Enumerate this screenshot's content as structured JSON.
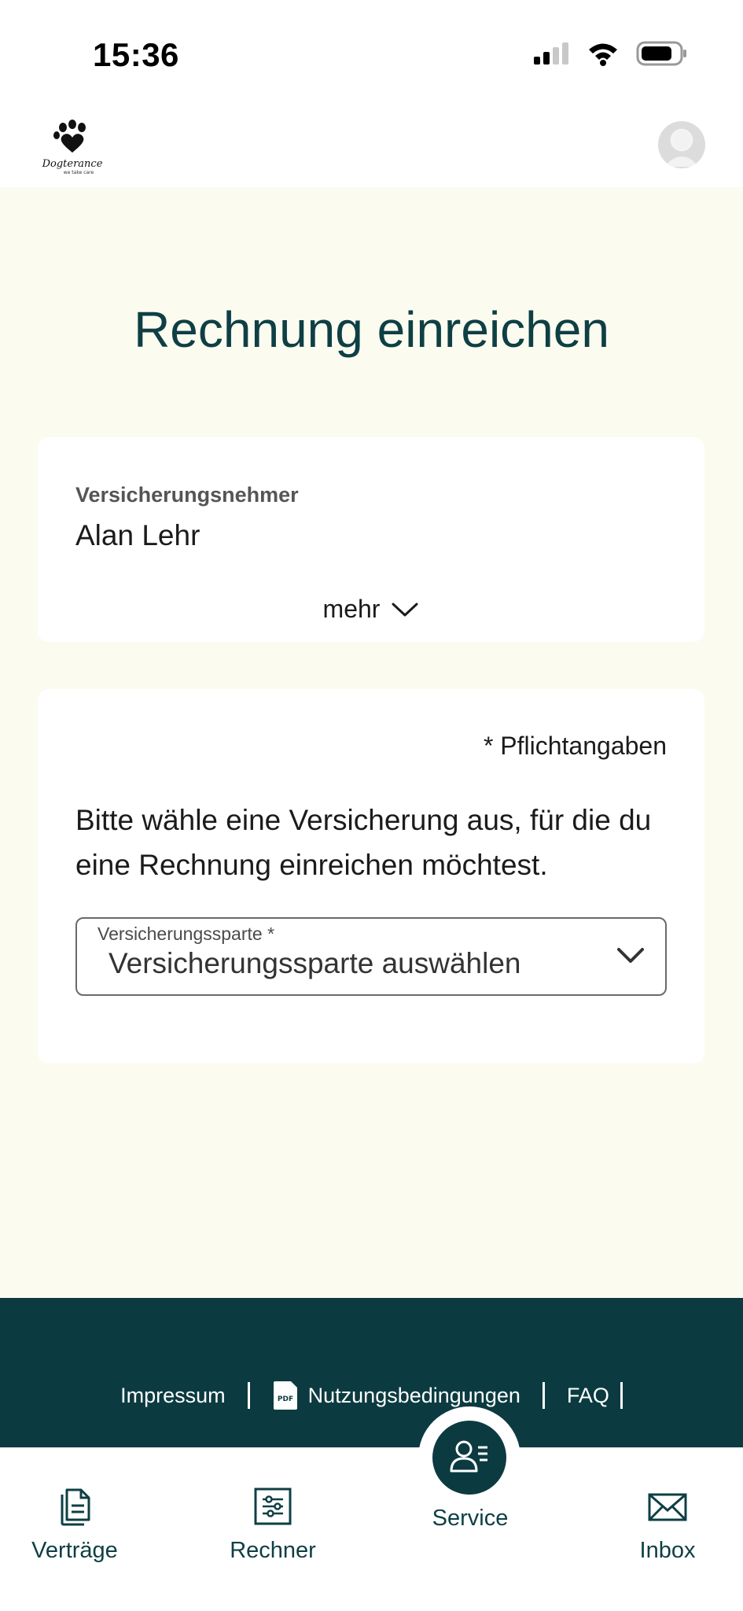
{
  "status_bar": {
    "time": "15:36"
  },
  "header": {
    "logo_text": "Dogterance",
    "logo_tagline": "we take care"
  },
  "page": {
    "title": "Rechnung einreichen"
  },
  "holder_card": {
    "label": "Versicherungsnehmer",
    "name": "Alan Lehr",
    "more_label": "mehr"
  },
  "form_card": {
    "required_note": "* Pflichtangaben",
    "instruction": "Bitte wähle eine Versicherung aus, für die du eine Rechnung einreichen möchtest.",
    "select": {
      "label": "Versicherungssparte *",
      "value": "Versicherungssparte auswählen"
    }
  },
  "footer": {
    "links": [
      {
        "label": "Impressum"
      },
      {
        "label": "Nutzungsbedingungen",
        "icon_text": "PDF"
      },
      {
        "label": "FAQ"
      }
    ]
  },
  "bottom_nav": {
    "items": [
      {
        "label": "Verträge",
        "icon": "contract-icon"
      },
      {
        "label": "Rechner",
        "icon": "calculator-icon"
      },
      {
        "label": "Service",
        "icon": "service-icon"
      },
      {
        "label": "Inbox",
        "icon": "inbox-icon"
      }
    ]
  },
  "colors": {
    "brand": "#0b3b41",
    "title": "#0e3f44",
    "background": "#fbfbf0"
  }
}
